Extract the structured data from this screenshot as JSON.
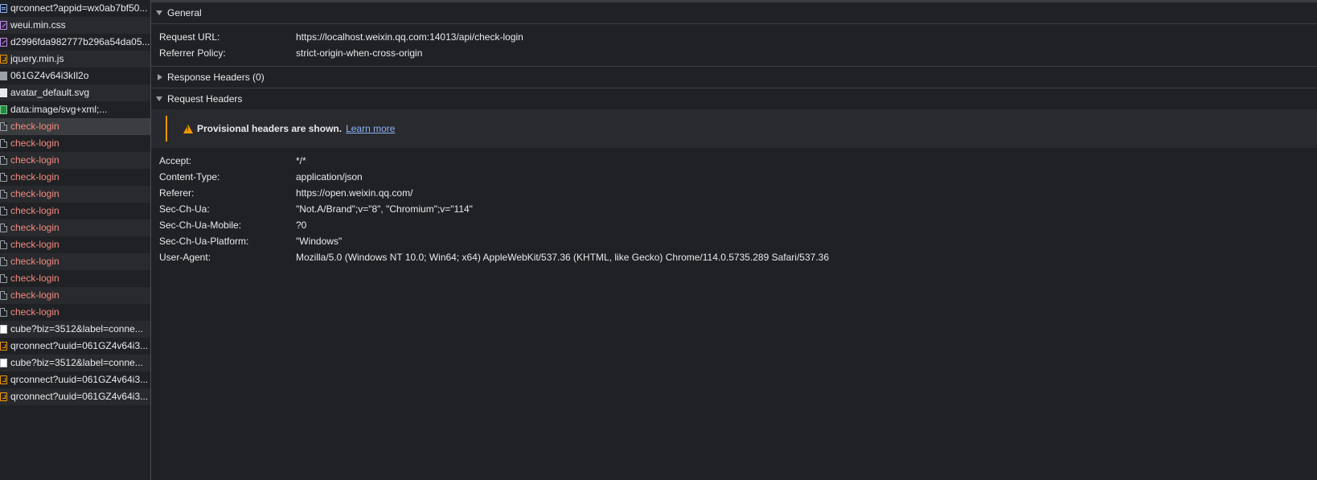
{
  "requests": [
    {
      "name": "qrconnect?appid=wx0ab7bf50...",
      "icon": "document-icon",
      "failed": false
    },
    {
      "name": "weui.min.css",
      "icon": "stylesheet-icon",
      "failed": false
    },
    {
      "name": "d2996fda982777b296a54da05...",
      "icon": "stylesheet-icon",
      "failed": false
    },
    {
      "name": "jquery.min.js",
      "icon": "script-icon",
      "failed": false
    },
    {
      "name": "061GZ4v64i3kIl2o",
      "icon": "image-icon",
      "failed": false
    },
    {
      "name": "avatar_default.svg",
      "icon": "svg-image-icon",
      "failed": false
    },
    {
      "name": "data:image/svg+xml;...",
      "icon": "data-image-icon",
      "failed": false
    },
    {
      "name": "check-login",
      "icon": "fetch-icon",
      "failed": true,
      "selected": true
    },
    {
      "name": "check-login",
      "icon": "fetch-icon",
      "failed": true
    },
    {
      "name": "check-login",
      "icon": "fetch-icon",
      "failed": true
    },
    {
      "name": "check-login",
      "icon": "fetch-icon",
      "failed": true
    },
    {
      "name": "check-login",
      "icon": "fetch-icon",
      "failed": true
    },
    {
      "name": "check-login",
      "icon": "fetch-icon",
      "failed": true
    },
    {
      "name": "check-login",
      "icon": "fetch-icon",
      "failed": true
    },
    {
      "name": "check-login",
      "icon": "fetch-icon",
      "failed": true
    },
    {
      "name": "check-login",
      "icon": "fetch-icon",
      "failed": true
    },
    {
      "name": "check-login",
      "icon": "fetch-icon",
      "failed": true
    },
    {
      "name": "check-login",
      "icon": "fetch-icon",
      "failed": true
    },
    {
      "name": "check-login",
      "icon": "fetch-icon",
      "failed": true
    },
    {
      "name": "cube?biz=3512&label=conne...",
      "icon": "ping-icon",
      "failed": false
    },
    {
      "name": "qrconnect?uuid=061GZ4v64i3...",
      "icon": "script-icon",
      "failed": false
    },
    {
      "name": "cube?biz=3512&label=conne...",
      "icon": "ping-icon",
      "failed": false
    },
    {
      "name": "qrconnect?uuid=061GZ4v64i3...",
      "icon": "script-icon",
      "failed": false
    },
    {
      "name": "qrconnect?uuid=061GZ4v64i3...",
      "icon": "script-icon",
      "failed": false
    }
  ],
  "general": {
    "title": "General",
    "rows": [
      {
        "key": "Request URL:",
        "value": "https://localhost.weixin.qq.com:14013/api/check-login"
      },
      {
        "key": "Referrer Policy:",
        "value": "strict-origin-when-cross-origin"
      }
    ]
  },
  "response_headers": {
    "title": "Response Headers (0)"
  },
  "request_headers": {
    "title": "Request Headers",
    "provisional_text": "Provisional headers are shown.",
    "learn_more": "Learn more",
    "rows": [
      {
        "key": "Accept:",
        "value": "*/*"
      },
      {
        "key": "Content-Type:",
        "value": "application/json"
      },
      {
        "key": "Referer:",
        "value": "https://open.weixin.qq.com/"
      },
      {
        "key": "Sec-Ch-Ua:",
        "value": "\"Not.A/Brand\";v=\"8\", \"Chromium\";v=\"114\""
      },
      {
        "key": "Sec-Ch-Ua-Mobile:",
        "value": "?0"
      },
      {
        "key": "Sec-Ch-Ua-Platform:",
        "value": "\"Windows\""
      },
      {
        "key": "User-Agent:",
        "value": "Mozilla/5.0 (Windows NT 10.0; Win64; x64) AppleWebKit/537.36 (KHTML, like Gecko) Chrome/114.0.5735.289 Safari/537.36"
      }
    ]
  },
  "colors": {
    "background": "#202124",
    "failed_text": "#f28b82",
    "warning": "#f29900",
    "link": "#8ab4f8"
  }
}
